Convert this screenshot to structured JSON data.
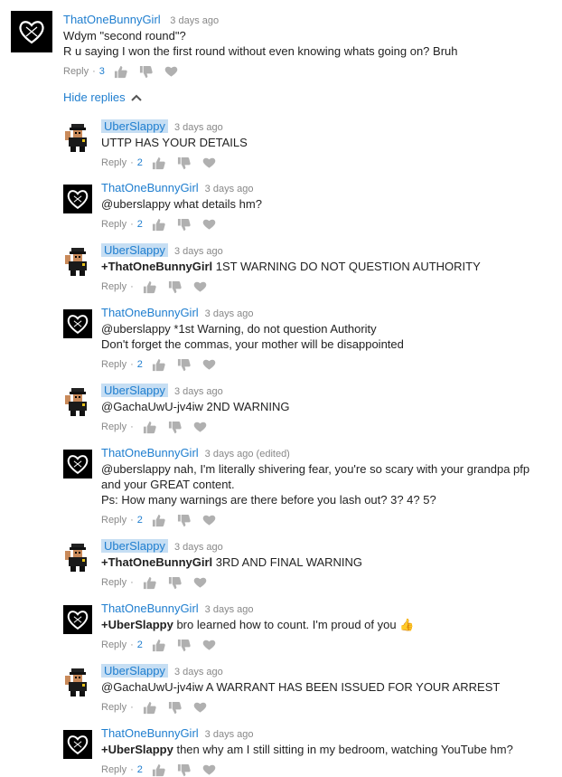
{
  "top": {
    "author": "ThatOneBunnyGirl",
    "time": "3 days ago",
    "text": "Wdym \"second round\"?\nR u saying I won the first round without even knowing whats going on? Bruh",
    "reply_label": "Reply",
    "likes": "3"
  },
  "hide_replies_label": "Hide replies",
  "replies": [
    {
      "author": "UberSlappy",
      "op": true,
      "time": "3 days ago",
      "mention": "",
      "text": "UTTP HAS YOUR DETAILS",
      "likes": "2"
    },
    {
      "author": "ThatOneBunnyGirl",
      "op": false,
      "time": "3 days ago",
      "mention": "",
      "text": "@uberslappy  what details hm?",
      "likes": "2"
    },
    {
      "author": "UberSlappy",
      "op": true,
      "time": "3 days ago",
      "mention": "+ThatOneBunnyGirl",
      "text": " 1ST WARNING DO NOT QUESTION AUTHORITY",
      "likes": ""
    },
    {
      "author": "ThatOneBunnyGirl",
      "op": false,
      "time": "3 days ago",
      "mention": "",
      "text": "@uberslappy  *1st Warning, do not question Authority\nDon't forget the commas, your mother will be disappointed",
      "likes": "2"
    },
    {
      "author": "UberSlappy",
      "op": true,
      "time": "3 days ago",
      "mention": "",
      "text": "@GachaUwU-jv4iw  2ND WARNING",
      "likes": ""
    },
    {
      "author": "ThatOneBunnyGirl",
      "op": false,
      "time": "3 days ago (edited)",
      "mention": "",
      "text": "@uberslappy  nah, I'm literally shivering fear, you're so scary with your grandpa pfp\nand your GREAT content.\nPs: How many warnings are there before you lash out? 3? 4? 5?",
      "likes": "2"
    },
    {
      "author": "UberSlappy",
      "op": true,
      "time": "3 days ago",
      "mention": "+ThatOneBunnyGirl",
      "text": " 3RD AND FINAL WARNING",
      "likes": ""
    },
    {
      "author": "ThatOneBunnyGirl",
      "op": false,
      "time": "3 days ago",
      "mention": "+UberSlappy",
      "text": " bro learned how to count. I'm proud of you 👍",
      "likes": "2"
    },
    {
      "author": "UberSlappy",
      "op": true,
      "time": "3 days ago",
      "mention": "",
      "text": "@GachaUwU-jv4iw  A WARRANT HAS BEEN ISSUED FOR YOUR ARREST",
      "likes": ""
    },
    {
      "author": "ThatOneBunnyGirl",
      "op": false,
      "time": "3 days ago",
      "mention": "+UberSlappy",
      "text": " then why am I still sitting in my bedroom, watching YouTube hm?",
      "likes": "2"
    }
  ],
  "colors": {
    "link": "#1f7ecf",
    "op_bg": "#c6def3",
    "muted": "#888888"
  }
}
